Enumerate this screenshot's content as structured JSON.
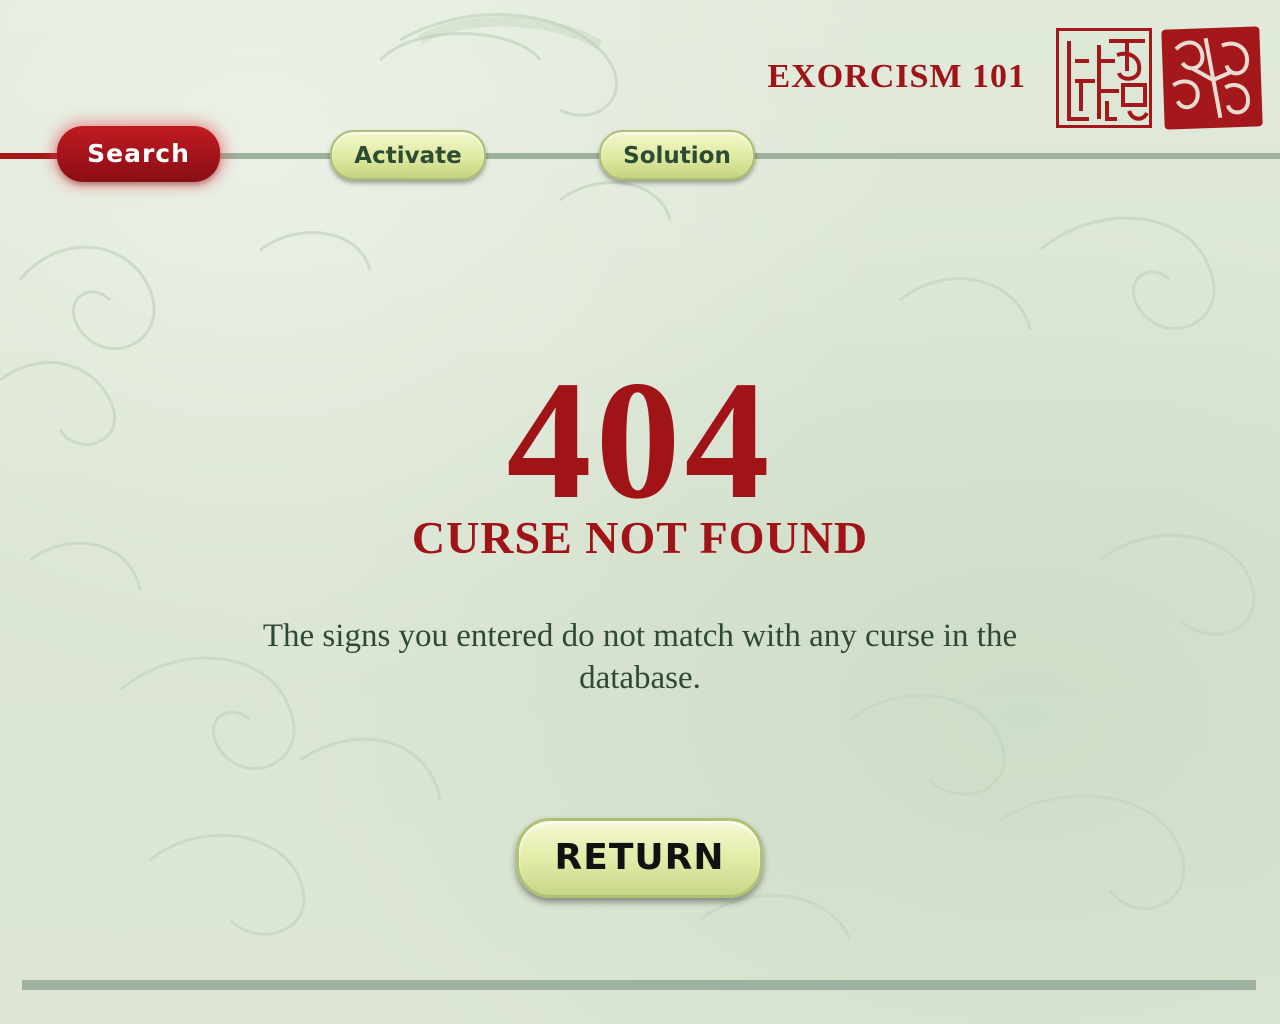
{
  "brand": {
    "title": "EXORCISM 101"
  },
  "nav": {
    "items": [
      {
        "label": "Search",
        "state": "active"
      },
      {
        "label": "Activate",
        "state": "inactive"
      },
      {
        "label": "Solution",
        "state": "inactive"
      }
    ]
  },
  "error": {
    "code": "404",
    "title": "CURSE NOT FOUND",
    "message": "The signs you entered do not match with any curse in the database."
  },
  "actions": {
    "return_label": "RETURN"
  },
  "colors": {
    "accent_red": "#a01418",
    "background": "#dfe8d6",
    "button_green": "#e3eca8",
    "text_dark_green": "#2e4a37"
  },
  "icons": {
    "seal_left": "red-seal-stamp-icon",
    "seal_right": "red-seal-stamp-icon"
  }
}
